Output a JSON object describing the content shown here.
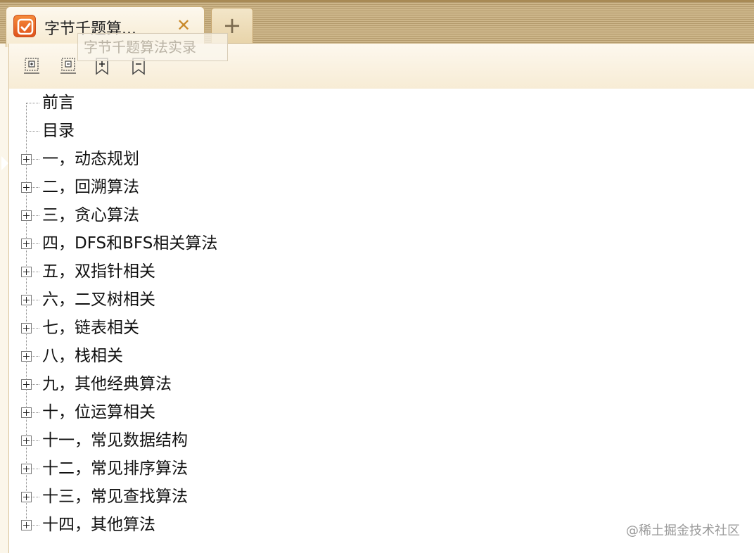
{
  "tab": {
    "title": "字节千题算...",
    "close_glyph": "✕",
    "logo_icon": "app-logo-icon"
  },
  "new_tab_glyph": "+",
  "tooltip": "字节千题算法实录",
  "toolbar": {
    "buttons": [
      {
        "name": "expand-all-icon"
      },
      {
        "name": "collapse-all-icon"
      },
      {
        "name": "add-bookmark-icon"
      },
      {
        "name": "remove-bookmark-icon"
      }
    ]
  },
  "tree": {
    "items": [
      {
        "label": "前言",
        "expandable": false
      },
      {
        "label": "目录",
        "expandable": false
      },
      {
        "label": "一，动态规划",
        "expandable": true
      },
      {
        "label": "二，回溯算法",
        "expandable": true
      },
      {
        "label": "三，贪心算法",
        "expandable": true
      },
      {
        "label": "四，DFS和BFS相关算法",
        "expandable": true
      },
      {
        "label": "五，双指针相关",
        "expandable": true
      },
      {
        "label": "六，二叉树相关",
        "expandable": true
      },
      {
        "label": "七，链表相关",
        "expandable": true
      },
      {
        "label": "八，栈相关",
        "expandable": true
      },
      {
        "label": "九，其他经典算法",
        "expandable": true
      },
      {
        "label": "十，位运算相关",
        "expandable": true
      },
      {
        "label": "十一，常见数据结构",
        "expandable": true
      },
      {
        "label": "十二，常见排序算法",
        "expandable": true
      },
      {
        "label": "十三，常见查找算法",
        "expandable": true
      },
      {
        "label": "十四，其他算法",
        "expandable": true
      }
    ]
  },
  "watermark": "@稀土掘金技术社区"
}
